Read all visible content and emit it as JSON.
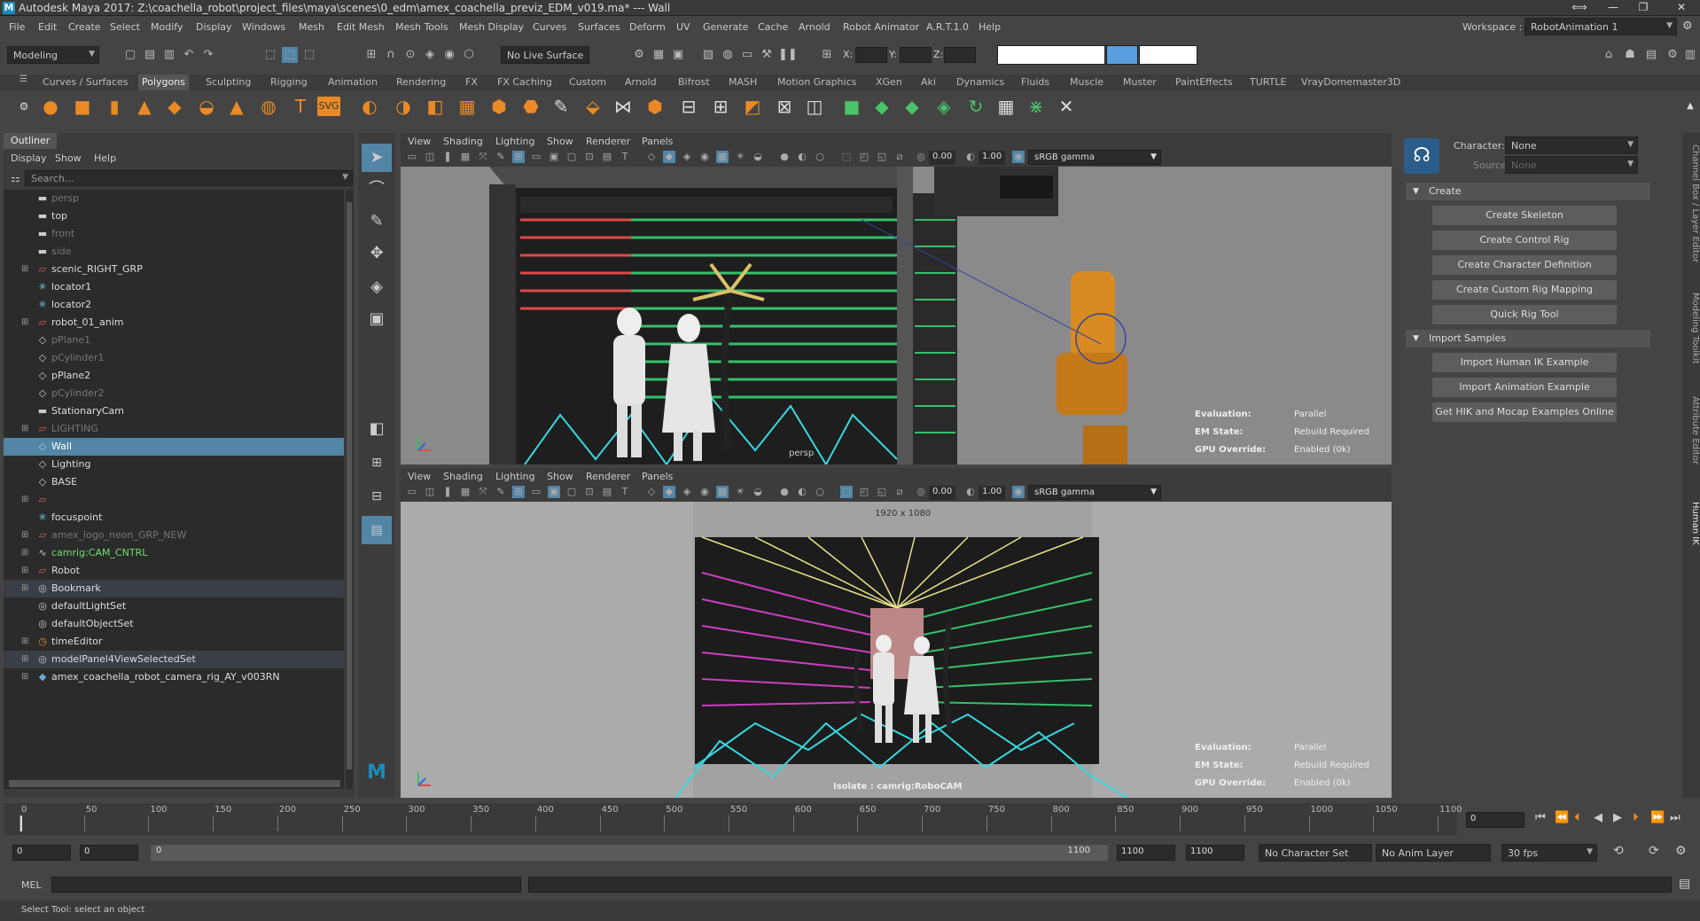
{
  "titlebar": {
    "title": "Autodesk Maya 2017: Z:\\coachella_robot\\project_files\\maya\\scenes\\0_edm\\amex_coachella_previz_EDM_v019.ma*   ---   Wall",
    "logo": "M"
  },
  "menu": [
    "File",
    "Edit",
    "Create",
    "Select",
    "Modify",
    "Display",
    "Windows",
    "Mesh",
    "Edit Mesh",
    "Mesh Tools",
    "Mesh Display",
    "Curves",
    "Surfaces",
    "Deform",
    "UV",
    "Generate",
    "Cache",
    "Arnold",
    "Robot Animator",
    "A.R.T.1.0",
    "Help"
  ],
  "workspace": {
    "label": "Workspace :",
    "value": "RobotAnimation 1"
  },
  "status": {
    "mode": "Modeling",
    "live_surface": "No Live Surface",
    "x_label": "X:",
    "y_label": "Y:",
    "z_label": "Z:"
  },
  "shelf_tabs": [
    "Curves / Surfaces",
    "Polygons",
    "Sculpting",
    "Rigging",
    "Animation",
    "Rendering",
    "FX",
    "FX Caching",
    "Custom",
    "Arnold",
    "Bifrost",
    "MASH",
    "Motion Graphics",
    "XGen",
    "Aki",
    "Dynamics",
    "Fluids",
    "Muscle",
    "Muster",
    "PaintEffects",
    "TURTLE",
    "VrayDomemaster3D"
  ],
  "shelf_active": "Polygons",
  "shelf_svg_label": "SVG",
  "shelf_text_label": "T",
  "outliner": {
    "tab": "Outliner",
    "menu": [
      "Display",
      "Show",
      "Help"
    ],
    "search_placeholder": "Search...",
    "items": [
      {
        "label": "persp",
        "icon": "camera-icon",
        "dim": true
      },
      {
        "label": "top",
        "icon": "camera-icon"
      },
      {
        "label": "front",
        "icon": "camera-icon",
        "dim": true
      },
      {
        "label": "side",
        "icon": "camera-icon",
        "dim": true
      },
      {
        "label": "scenic_RIGHT_GRP",
        "icon": "group-icon",
        "expand": true
      },
      {
        "label": "locator1",
        "icon": "locator-icon"
      },
      {
        "label": "locator2",
        "icon": "locator-icon"
      },
      {
        "label": "robot_01_anim",
        "icon": "group-icon",
        "expand": true
      },
      {
        "label": "pPlane1",
        "icon": "mesh-icon",
        "dim": true
      },
      {
        "label": "pCylinder1",
        "icon": "mesh-icon",
        "dim": true
      },
      {
        "label": "pPlane2",
        "icon": "mesh-icon"
      },
      {
        "label": "pCylinder2",
        "icon": "mesh-icon",
        "dim": true
      },
      {
        "label": "StationaryCam",
        "icon": "camera-icon"
      },
      {
        "label": "LIGHTING",
        "icon": "group-icon",
        "expand": true,
        "dim": true
      },
      {
        "label": "Wall",
        "icon": "mesh-icon",
        "selected": true
      },
      {
        "label": "Lighting",
        "icon": "mesh-icon"
      },
      {
        "label": "BASE",
        "icon": "mesh-icon"
      },
      {
        "label": "",
        "icon": "group-icon",
        "expand": true,
        "red": true
      },
      {
        "label": "focuspoint",
        "icon": "locator-icon"
      },
      {
        "label": "amex_logo_neon_GRP_NEW",
        "icon": "group-icon",
        "expand": true,
        "dim": true
      },
      {
        "label": "camrig:CAM_CNTRL",
        "icon": "curve-icon",
        "expand": true,
        "green": true
      },
      {
        "label": "Robot",
        "icon": "group-icon",
        "expand": true
      },
      {
        "label": "Bookmark",
        "icon": "set-icon",
        "expand": true,
        "highlight": true
      },
      {
        "label": "defaultLightSet",
        "icon": "set-icon"
      },
      {
        "label": "defaultObjectSet",
        "icon": "set-icon"
      },
      {
        "label": "timeEditor",
        "icon": "clock-icon",
        "expand": true
      },
      {
        "label": "modelPanel4ViewSelectedSet",
        "icon": "set-icon",
        "expand": true,
        "highlight": true
      },
      {
        "label": "amex_coachella_robot_camera_rig_AY_v003RN",
        "icon": "reference-icon",
        "expand": true
      }
    ]
  },
  "viewport_menu": [
    "View",
    "Shading",
    "Lighting",
    "Show",
    "Renderer",
    "Panels"
  ],
  "viewport_values": {
    "exposure": "0.00",
    "gamma": "1.00",
    "colorspace": "sRGB gamma"
  },
  "viewport_top": {
    "camera_label": "persp",
    "hud": [
      {
        "key": "Evaluation:",
        "value": "Parallel"
      },
      {
        "key": "EM State:",
        "value": "Rebuild Required"
      },
      {
        "key": "GPU Override:",
        "value": "Enabled (0k)"
      }
    ]
  },
  "viewport_bottom": {
    "resolution": "1920 x 1080",
    "isolate": "Isolate : camrig:RoboCAM",
    "hud": [
      {
        "key": "Evaluation:",
        "value": "Parallel"
      },
      {
        "key": "EM State:",
        "value": "Rebuild Required"
      },
      {
        "key": "GPU Override:",
        "value": "Enabled (0k)"
      }
    ]
  },
  "hik": {
    "character_label": "Character:",
    "character_value": "None",
    "source_label": "Source:",
    "source_value": "None",
    "sections": [
      {
        "title": "Create",
        "buttons": [
          "Create Skeleton",
          "Create Control Rig",
          "Create Character Definition",
          "Create Custom Rig Mapping",
          "Quick Rig Tool"
        ]
      },
      {
        "title": "Import Samples",
        "buttons": [
          "Import Human IK Example",
          "Import Animation Example",
          "Get HIK and Mocap Examples Online"
        ]
      }
    ]
  },
  "side_tabs": [
    "Channel Box / Layer Editor",
    "Modeling Toolkit",
    "Attribute Editor",
    "Human IK"
  ],
  "timeline": {
    "ticks": [
      "0",
      "50",
      "100",
      "150",
      "200",
      "250",
      "300",
      "350",
      "400",
      "450",
      "500",
      "550",
      "600",
      "650",
      "700",
      "750",
      "800",
      "850",
      "900",
      "950",
      "1000",
      "1050",
      "1100"
    ],
    "current_frame": "0"
  },
  "range": {
    "start": "0",
    "playback_start": "0",
    "slider_start": "0",
    "slider_end": "1100",
    "playback_end": "1100",
    "end": "1100",
    "character_set": "No Character Set",
    "anim_layer": "No Anim Layer",
    "fps": "30 fps"
  },
  "mel": {
    "label": "MEL"
  },
  "help_line": "Select Tool: select an object",
  "colors": {
    "accent": "#5285a6",
    "bg": "#444444",
    "viewport_bg": "#8e8e8e"
  }
}
